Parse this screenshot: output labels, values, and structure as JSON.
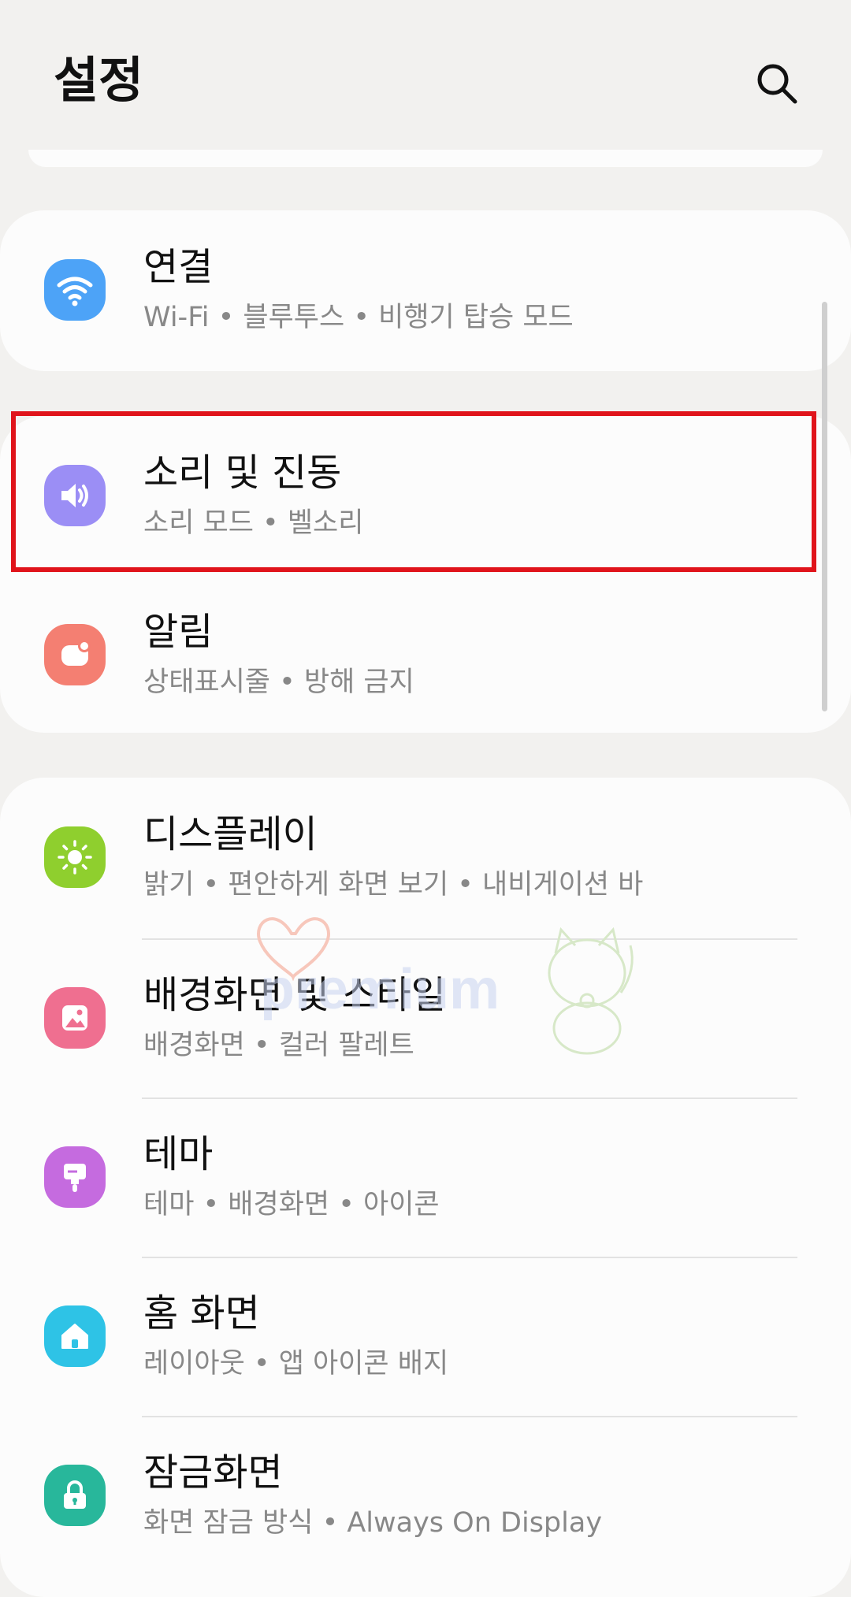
{
  "header": {
    "title": "설정",
    "search_icon": "search-icon"
  },
  "sections": [
    {
      "items": [
        {
          "id": "connections",
          "title": "연결",
          "subtitle": "Wi-Fi  •  블루투스  •  비행기 탑승 모드",
          "icon": "wifi-icon",
          "icon_color": "#4da3f7"
        }
      ]
    },
    {
      "items": [
        {
          "id": "sound",
          "title": "소리 및 진동",
          "subtitle": "소리 모드  •  벨소리",
          "icon": "speaker-icon",
          "icon_color": "#9b8ef5",
          "highlighted": true
        },
        {
          "id": "notifications",
          "title": "알림",
          "subtitle": "상태표시줄  •  방해 금지",
          "icon": "notification-icon",
          "icon_color": "#f47f72"
        }
      ]
    },
    {
      "items": [
        {
          "id": "display",
          "title": "디스플레이",
          "subtitle": "밝기  •  편안하게 화면 보기  •  내비게이션 바",
          "icon": "sun-icon",
          "icon_color": "#8fcf2e"
        },
        {
          "id": "wallpaper",
          "title": "배경화면 및 스타일",
          "subtitle": "배경화면  •  컬러 팔레트",
          "icon": "image-icon",
          "icon_color": "#ef6f90"
        },
        {
          "id": "themes",
          "title": "테마",
          "subtitle": "테마  •  배경화면  •  아이콘",
          "icon": "paintbrush-icon",
          "icon_color": "#c56bdf"
        },
        {
          "id": "home",
          "title": "홈 화면",
          "subtitle": "레이아웃  •  앱 아이콘 배지",
          "icon": "home-icon",
          "icon_color": "#2ec3e6"
        },
        {
          "id": "lockscreen",
          "title": "잠금화면",
          "subtitle": "화면 잠금 방식  •  Always On Display",
          "icon": "lock-icon",
          "icon_color": "#28b79b"
        }
      ]
    }
  ],
  "watermark": {
    "text": "premium"
  },
  "colors": {
    "background": "#f2f1ef",
    "card": "#fcfcfc",
    "highlight_border": "#e0141b"
  }
}
